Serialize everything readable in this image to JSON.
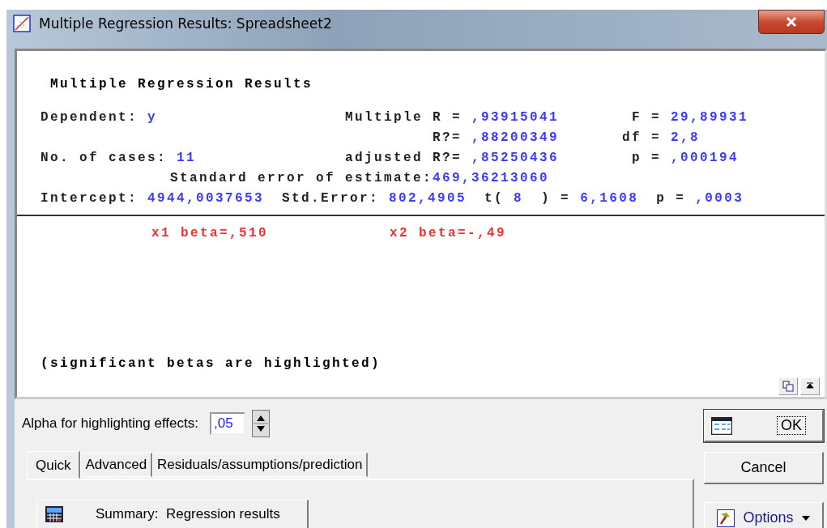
{
  "window": {
    "title": "Multiple Regression Results: Spreadsheet2"
  },
  "output": {
    "heading": "Multiple Regression Results",
    "summary_rows": [
      {
        "left": {
          "label": "Dependent:",
          "value": "y"
        },
        "middle": {
          "label": "Multiple R =",
          "value": ",93915041"
        },
        "right": {
          "label": "F =",
          "value": "29,89931"
        }
      },
      {
        "middle": {
          "label": "R?=",
          "value": ",88200349"
        },
        "right": {
          "label": "df =",
          "value": "2,8"
        }
      },
      {
        "left": {
          "label": "No. of cases:",
          "value": "11"
        },
        "middle": {
          "label": "adjusted R?=",
          "value": ",85250436"
        },
        "right": {
          "label": "p =",
          "value": ",000194"
        }
      }
    ],
    "std_error": {
      "label": "Standard error of estimate:",
      "value": "469,36213060"
    },
    "intercept_row": [
      {
        "label": "Intercept:",
        "value": "4944,0037653"
      },
      {
        "label": "Std.Error:",
        "value": "802,4905"
      },
      {
        "label": "t(",
        "value": "8"
      },
      {
        "label": ") =",
        "value": "6,1608"
      },
      {
        "label": "p =",
        "value": ",0003"
      }
    ],
    "betas": [
      {
        "text": "x1 beta=,510",
        "significant": true
      },
      {
        "text": "x2 beta=-,49",
        "significant": true
      }
    ],
    "note": "(significant betas are highlighted)"
  },
  "alpha": {
    "label": "Alpha for highlighting effects:",
    "value": ",05"
  },
  "tabs": [
    {
      "label": "Quick",
      "selected": true
    },
    {
      "label": "Advanced",
      "selected": false
    },
    {
      "label": "Residuals/assumptions/prediction",
      "selected": false
    }
  ],
  "summary_button": "Summary:  Regression results",
  "buttons": [
    {
      "kind": "ok",
      "label": "OK"
    },
    {
      "kind": "cancel",
      "label": "Cancel"
    },
    {
      "kind": "options",
      "label": "Options"
    }
  ]
}
